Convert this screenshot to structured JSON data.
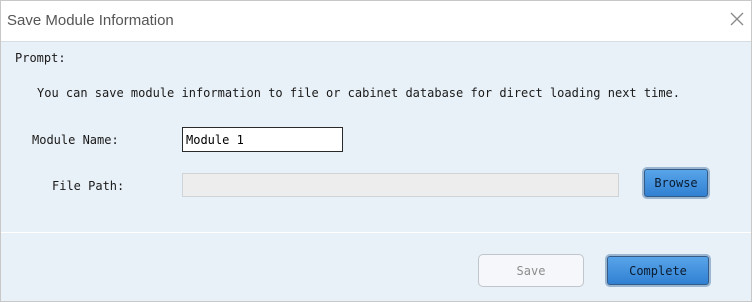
{
  "dialog": {
    "title": "Save Module Information",
    "close_icon": "close-icon"
  },
  "prompt": {
    "label": "Prompt:",
    "text": "You can save module information to file or cabinet database for direct loading next time."
  },
  "module_name": {
    "label": "Module Name:",
    "value": "Module 1"
  },
  "file_path": {
    "label": "File Path:",
    "value": "",
    "browse_label": "Browse"
  },
  "actions": {
    "save_label": "Save",
    "complete_label": "Complete"
  },
  "colors": {
    "dialog_background": "#e9f1f8",
    "primary_button": "#3f8fdc",
    "title_text": "#555555"
  }
}
